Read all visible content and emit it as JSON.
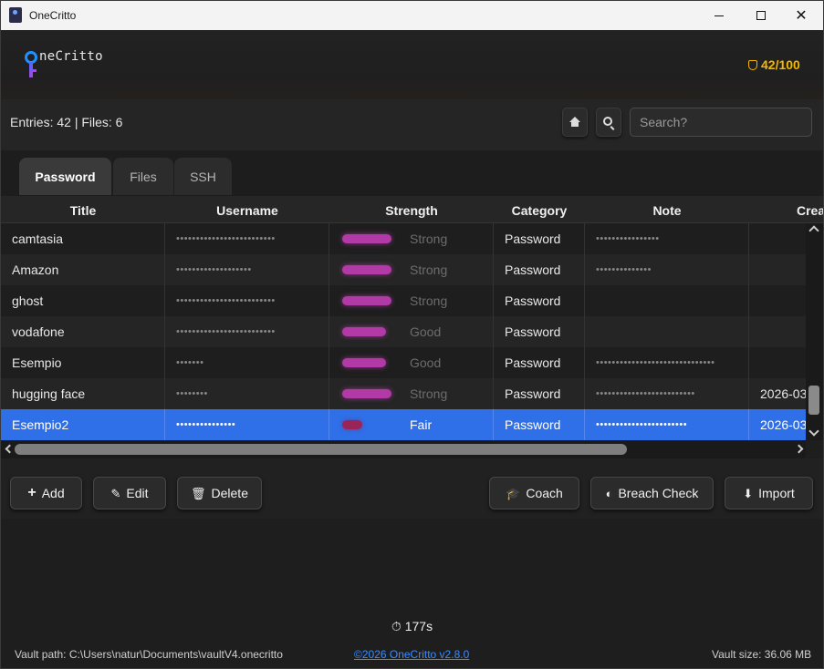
{
  "window": {
    "title": "OneCritto"
  },
  "header": {
    "logo_text": "neCritto",
    "score": "42/100"
  },
  "toolbar": {
    "counts": "Entries: 42 | Files: 6",
    "search_placeholder": "Search?"
  },
  "tabs": [
    {
      "label": "Password",
      "active": true
    },
    {
      "label": "Files",
      "active": false
    },
    {
      "label": "SSH",
      "active": false
    }
  ],
  "table": {
    "columns": [
      "Title",
      "Username",
      "Strength",
      "Category",
      "Note",
      "Crea"
    ],
    "rows": [
      {
        "title": "camtasia",
        "username": "•••••••••••••••••••••••••",
        "strength": "Strong",
        "strength_level": 0.85,
        "category": "Password",
        "note": "••••••••••••••••",
        "created": ""
      },
      {
        "title": "Amazon",
        "username": "•••••••••••••••••••",
        "strength": "Strong",
        "strength_level": 0.85,
        "category": "Password",
        "note": "••••••••••••••",
        "created": ""
      },
      {
        "title": "ghost",
        "username": "•••••••••••••••••••••••••",
        "strength": "Strong",
        "strength_level": 0.85,
        "category": "Password",
        "note": "",
        "created": ""
      },
      {
        "title": "vodafone",
        "username": "•••••••••••••••••••••••••",
        "strength": "Good",
        "strength_level": 0.75,
        "category": "Password",
        "note": "",
        "created": ""
      },
      {
        "title": "Esempio",
        "username": "•••••••",
        "strength": "Good",
        "strength_level": 0.75,
        "category": "Password",
        "note": "••••••••••••••••••••••••••••••",
        "created": ""
      },
      {
        "title": "hugging face",
        "username": "••••••••",
        "strength": "Strong",
        "strength_level": 0.85,
        "category": "Password",
        "note": "•••••••••••••••••••••••••",
        "created": "2026-03-"
      },
      {
        "title": "Esempio2",
        "username": "•••••••••••••••",
        "strength": "Fair",
        "strength_level": 0.35,
        "category": "Password",
        "note": "•••••••••••••••••••••••",
        "created": "2026-03-",
        "selected": true
      }
    ]
  },
  "actions": {
    "add": "Add",
    "edit": "Edit",
    "delete": "Delete",
    "coach": "Coach",
    "breach": "Breach Check",
    "import": "Import"
  },
  "footer": {
    "timer": "177s",
    "vault_path": "Vault path: C:\\Users\\natur\\Documents\\vaultV4.onecritto",
    "copyright": "©2026 OneCritto v2.8.0",
    "vault_size": "Vault size: 36.06 MB"
  },
  "colors": {
    "accent": "#2f6fe8",
    "score": "#f5b800",
    "strength": "#b13aa6",
    "link": "#3b8cff"
  },
  "icons": [
    "app-icon",
    "minimize-icon",
    "maximize-icon",
    "close-icon",
    "key-logo-icon",
    "shield-icon",
    "home-icon",
    "search-icon",
    "plus-icon",
    "edit-icon",
    "trash-icon",
    "graduation-cap-icon",
    "shield-half-icon",
    "download-icon",
    "stopwatch-icon"
  ]
}
